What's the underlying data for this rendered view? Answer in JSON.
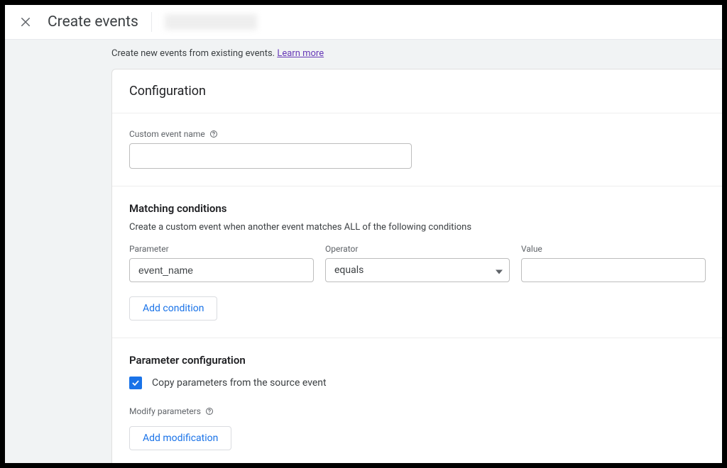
{
  "header": {
    "title": "Create events"
  },
  "description": {
    "text": "Create new events from existing events. ",
    "learn_more": "Learn more"
  },
  "config": {
    "title": "Configuration",
    "custom_event_label": "Custom event name",
    "custom_event_value": "",
    "matching": {
      "title": "Matching conditions",
      "subtitle": "Create a custom event when another event matches ALL of the following conditions",
      "parameter_label": "Parameter",
      "parameter_value": "event_name",
      "operator_label": "Operator",
      "operator_value": "equals",
      "value_label": "Value",
      "value_value": "",
      "add_condition": "Add condition"
    },
    "param_config": {
      "title": "Parameter configuration",
      "copy_label": "Copy parameters from the source event",
      "copy_checked": true,
      "modify_label": "Modify parameters",
      "add_modification": "Add modification"
    }
  }
}
